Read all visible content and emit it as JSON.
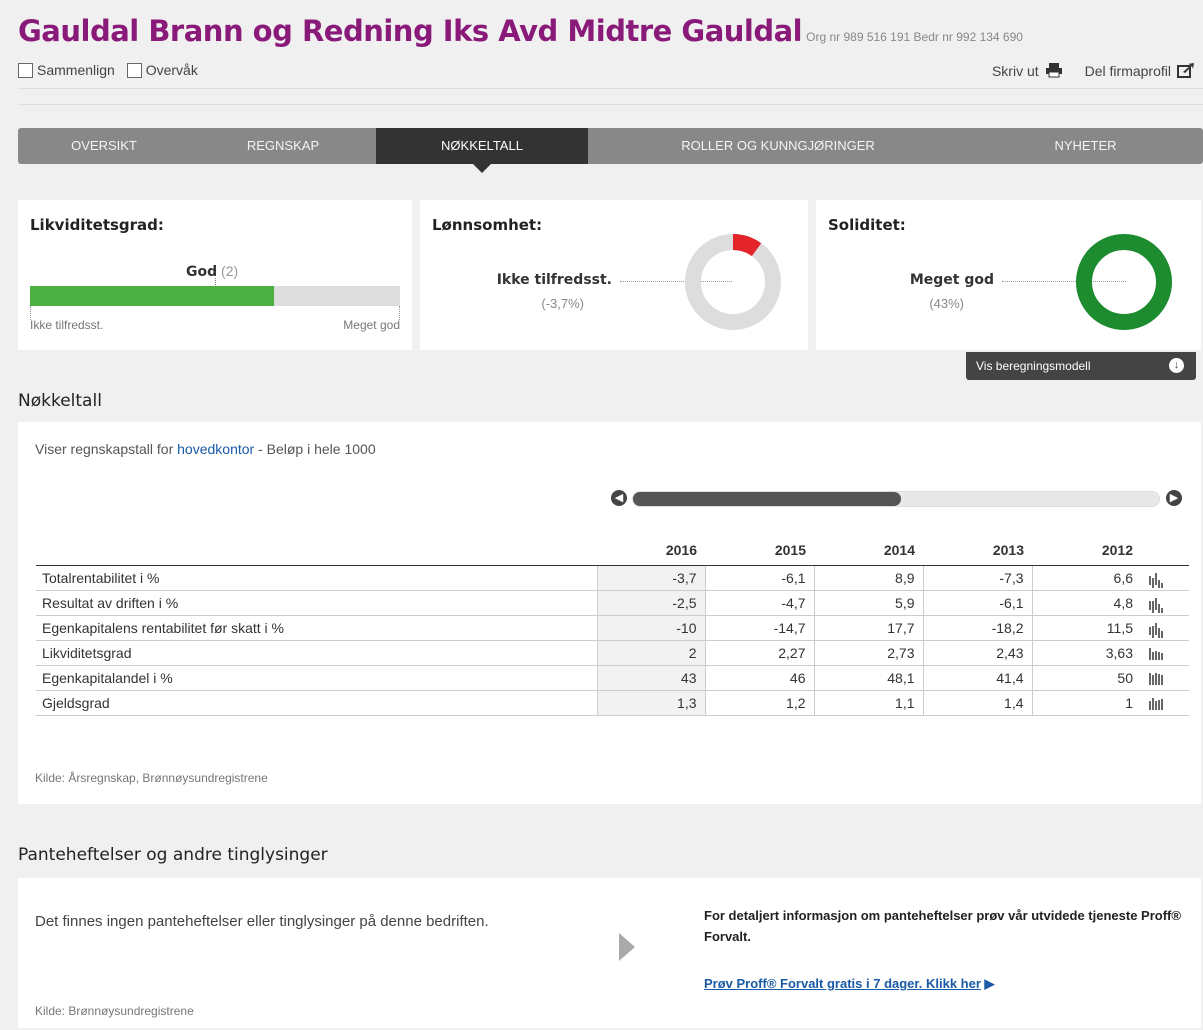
{
  "company": {
    "name": "Gauldal Brann og Redning Iks Avd Midtre Gauldal",
    "org_text": "Org nr 989 516 191 Bedr nr 992 134 690"
  },
  "toolbar": {
    "compare_label": "Sammenlign",
    "watch_label": "Overvåk",
    "print_label": "Skriv ut",
    "share_label": "Del firmaprofil"
  },
  "tabs": [
    {
      "label": "OVERSIKT"
    },
    {
      "label": "REGNSKAP"
    },
    {
      "label": "NØKKELTALL"
    },
    {
      "label": "ROLLER OG KUNNGJØRINGER"
    },
    {
      "label": "NYHETER"
    }
  ],
  "active_tab": "NØKKELTALL",
  "cards": {
    "liquidity": {
      "title": "Likviditetsgrad:",
      "rating": "God",
      "rating_score": "(2)",
      "fill_fraction": 0.66,
      "low_label": "Ikke tilfredsst.",
      "high_label": "Meget god",
      "bar_color": "#4caf42"
    },
    "profitability": {
      "title": "Lønnsomhet:",
      "rating": "Ikke tilfredsst.",
      "value": "(-3,7%)",
      "fraction": 0.1,
      "ring_color": "#e3242b"
    },
    "solidity": {
      "title": "Soliditet:",
      "rating": "Meget god",
      "value": "(43%)",
      "fraction": 1.0,
      "ring_color": "#1c8c2e"
    },
    "model_button": "Vis beregningsmodell"
  },
  "keyfigures": {
    "title": "Nøkkeltall",
    "intro_prefix": "Viser regnskapstall for ",
    "intro_link": "hovedkontor",
    "intro_suffix": " - Beløp i hele 1000",
    "years": [
      "2016",
      "2015",
      "2014",
      "2013",
      "2012"
    ],
    "rows": [
      {
        "label": "Totalrentabilitet i %",
        "values": [
          "-3,7",
          "-6,1",
          "8,9",
          "-7,3",
          "6,6"
        ],
        "spark": [
          -3.7,
          -6.1,
          8.9,
          -7.3,
          6.6
        ]
      },
      {
        "label": "Resultat av driften i %",
        "values": [
          "-2,5",
          "-4,7",
          "5,9",
          "-6,1",
          "4,8"
        ],
        "spark": [
          -2.5,
          -4.7,
          5.9,
          -6.1,
          4.8
        ]
      },
      {
        "label": "Egenkapitalens rentabilitet før skatt i %",
        "values": [
          "-10",
          "-14,7",
          "17,7",
          "-18,2",
          "11,5"
        ],
        "spark": [
          -10,
          -14.7,
          17.7,
          -18.2,
          11.5
        ]
      },
      {
        "label": "Likviditetsgrad",
        "values": [
          "2",
          "2,27",
          "2,73",
          "2,43",
          "3,63"
        ],
        "spark": [
          2,
          2.27,
          2.73,
          2.43,
          3.63
        ]
      },
      {
        "label": "Egenkapitalandel i %",
        "values": [
          "43",
          "46",
          "48,1",
          "41,4",
          "50"
        ],
        "spark": [
          43,
          46,
          48.1,
          41.4,
          50
        ]
      },
      {
        "label": "Gjeldsgrad",
        "values": [
          "1,3",
          "1,2",
          "1,1",
          "1,4",
          "1"
        ],
        "spark": [
          1.3,
          1.2,
          1.1,
          1.4,
          1
        ]
      }
    ],
    "source": "Kilde: Årsregnskap, Brønnøysundregistrene"
  },
  "liens": {
    "title": "Panteheftelser og andre tinglysinger",
    "text": "Det finnes ingen panteheftelser eller tinglysinger på denne bedriften.",
    "info": "For detaljert informasjon om panteheftelser prøv vår utvidede tjeneste Proff® Forvalt.",
    "cta": "Prøv Proff® Forvalt gratis i 7 dager. Klikk her",
    "source": "Kilde: Brønnøysundregistrene"
  }
}
